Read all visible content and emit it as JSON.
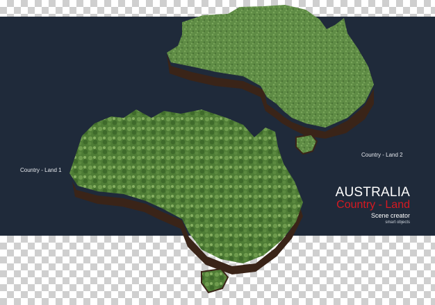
{
  "labels": {
    "land1": "Country - Land 1",
    "land2": "Country - Land 2"
  },
  "title": {
    "main": "AUSTRALIA",
    "sub": "Country - Land",
    "creator": "Scene creator",
    "objects": "smart objects"
  },
  "colors": {
    "backdrop": "#1f2a3a",
    "checker": "#cfcfcf",
    "grass": "#5f8c45",
    "soil": "#3a2418",
    "accent_red": "#d71921"
  }
}
